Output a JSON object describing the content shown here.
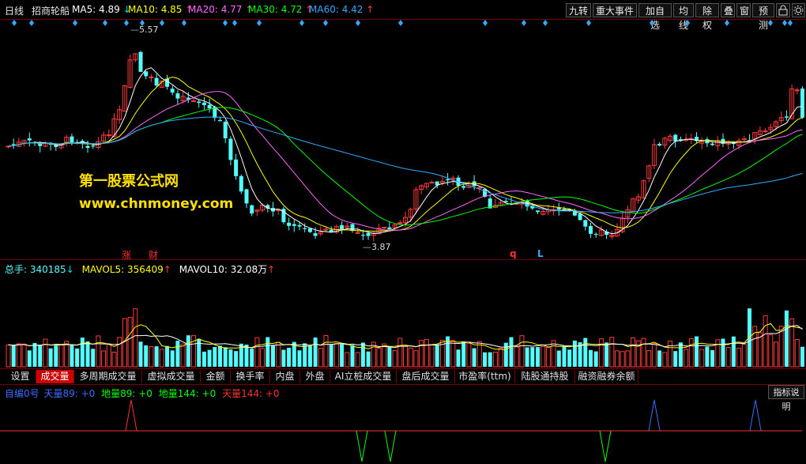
{
  "header": {
    "period": "日线",
    "stock_name": "招商轮船",
    "ma": [
      {
        "label": "MA5: 4.89",
        "arrow": "↓",
        "color": "#ffffff"
      },
      {
        "label": "MA10: 4.85",
        "arrow": "↑",
        "color": "#ffff00"
      },
      {
        "label": "MA20: 4.77",
        "arrow": "↑",
        "color": "#ff66ff"
      },
      {
        "label": "MA30: 4.72",
        "arrow": "↑",
        "color": "#00ff00"
      },
      {
        "label": "MA60: 4.42",
        "arrow": "↑",
        "color": "#33aaff"
      }
    ],
    "buttons": [
      "九转",
      "重大事件",
      "加自选",
      "均线",
      "除权",
      "叠",
      "窗",
      "预测"
    ]
  },
  "price_chart": {
    "high_label": "5.57",
    "low_label": "3.87",
    "markers": [
      "涨",
      "财",
      "q",
      "L"
    ],
    "watermark_name": "第一股票公式网",
    "watermark_url": "www.chnmoney.com"
  },
  "volume": {
    "total_label": "总手: 340185",
    "total_arrow": "↓",
    "mavol5_label": "MAVOL5: 356409",
    "mavol5_arrow": "↑",
    "mavol10_label": "MAVOL10: 32.08万",
    "mavol10_arrow": "↑"
  },
  "tabs": [
    "设置",
    "成交量",
    "多周期成交量",
    "虚拟成交量",
    "金额",
    "换手率",
    "内盘",
    "外盘",
    "AI立桩成交量",
    "盘后成交量",
    "市盈率(ttm)",
    "陆股通持股",
    "融资融券余额"
  ],
  "active_tab": "成交量",
  "indicator": {
    "name": "自编0号",
    "items": [
      {
        "label": "天量89: +0",
        "color": "#3b6bff"
      },
      {
        "label": "地量89: +0",
        "color": "#00ff00"
      },
      {
        "label": "地量144: +0",
        "color": "#00ff00"
      },
      {
        "label": "天量144: +0",
        "color": "#ff3030"
      }
    ],
    "help_button": "指标说明"
  },
  "colors": {
    "up": "#ff3b3b",
    "down": "#54ffff",
    "grid": "#7a0000",
    "ma5": "#ffffff",
    "ma10": "#ffff00",
    "ma20": "#ff66ff",
    "ma30": "#00ff00",
    "ma60": "#33aaff"
  }
}
